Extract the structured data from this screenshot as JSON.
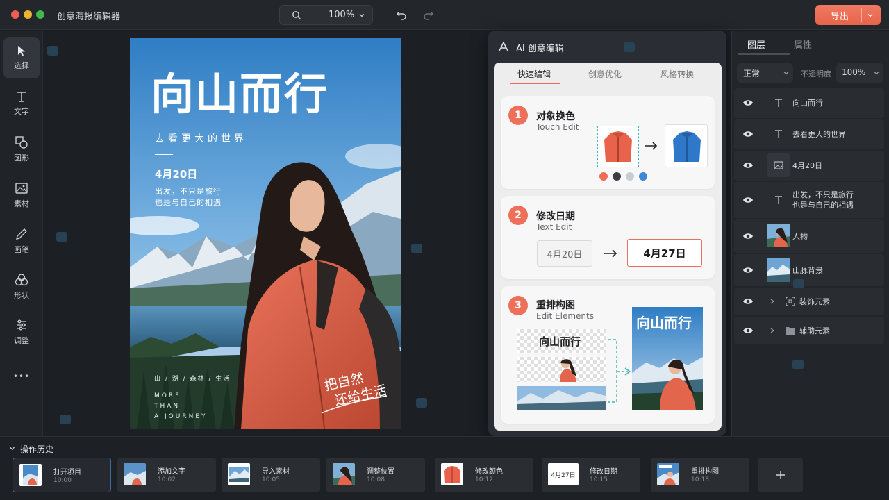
{
  "app": {
    "title": "创意海报编辑器"
  },
  "topbar": {
    "zoom": "100%",
    "export_label": "导出"
  },
  "tools": [
    {
      "label": "选择",
      "icon": "cursor-icon"
    },
    {
      "label": "文字",
      "icon": "text-icon"
    },
    {
      "label": "图形",
      "icon": "shapes-icon"
    },
    {
      "label": "素材",
      "icon": "image-icon"
    },
    {
      "label": "画笔",
      "icon": "pen-icon"
    },
    {
      "label": "形状",
      "icon": "circles-icon"
    },
    {
      "label": "调整",
      "icon": "sliders-icon"
    },
    {
      "label": "•••",
      "icon": "more-icon"
    }
  ],
  "poster": {
    "title": "向山而行",
    "subtitle": "去看更大的世界",
    "date": "4月20日",
    "line1": "出发，不只是旅行",
    "line2": "也是与自己的相遇",
    "tags": "山 / 湖 / 森林 / 生活",
    "more1": "MORE",
    "more2": "THAN",
    "more3": "A JOURNEY",
    "script1": "把自然",
    "script2": "还给生活"
  },
  "ai_panel": {
    "title": "AI 创意编辑",
    "tabs": [
      "快速编辑",
      "创意优化",
      "风格转换"
    ],
    "cards": [
      {
        "num": "1",
        "title": "对象换色",
        "sub": "Touch Edit"
      },
      {
        "num": "2",
        "title": "修改日期",
        "sub": "Text Edit",
        "old_date": "4月20日",
        "new_date": "4月27日"
      },
      {
        "num": "3",
        "title": "重排构图",
        "sub": "Edit Elements",
        "mini_title": "向山而行"
      }
    ],
    "swatches": [
      "#ef6a57",
      "#3a3d42",
      "#c9ccd0",
      "#3f86d6"
    ]
  },
  "right_panel": {
    "tabs": [
      "图层",
      "属性"
    ],
    "blend": "正常",
    "opacity_label": "不透明度",
    "opacity": "100%",
    "layers": [
      {
        "name": "向山而行",
        "type": "text-icon"
      },
      {
        "name": "去看更大的世界",
        "type": "text-icon"
      },
      {
        "name": "4月20日",
        "type": "image-icon"
      },
      {
        "name": "出发，不只是旅行",
        "name2": "也是与自己的相遇",
        "type": "text-icon"
      },
      {
        "name": "人物",
        "type": "thumb-person"
      },
      {
        "name": "山脉背景",
        "type": "thumb-mountain"
      },
      {
        "name": "装饰元素",
        "type": "frame-icon"
      },
      {
        "name": "辅助元素",
        "type": "folder-icon"
      }
    ]
  },
  "history": {
    "title": "操作历史",
    "items": [
      {
        "name": "打开项目",
        "time": "10:00"
      },
      {
        "name": "添加文字",
        "time": "10:02"
      },
      {
        "name": "导入素材",
        "time": "10:05"
      },
      {
        "name": "调整位置",
        "time": "10:08"
      },
      {
        "name": "修改颜色",
        "time": "10:12"
      },
      {
        "name": "修改日期",
        "time": "10:15",
        "thumb_text": "4月27日"
      },
      {
        "name": "重排构图",
        "time": "10:18"
      }
    ]
  }
}
